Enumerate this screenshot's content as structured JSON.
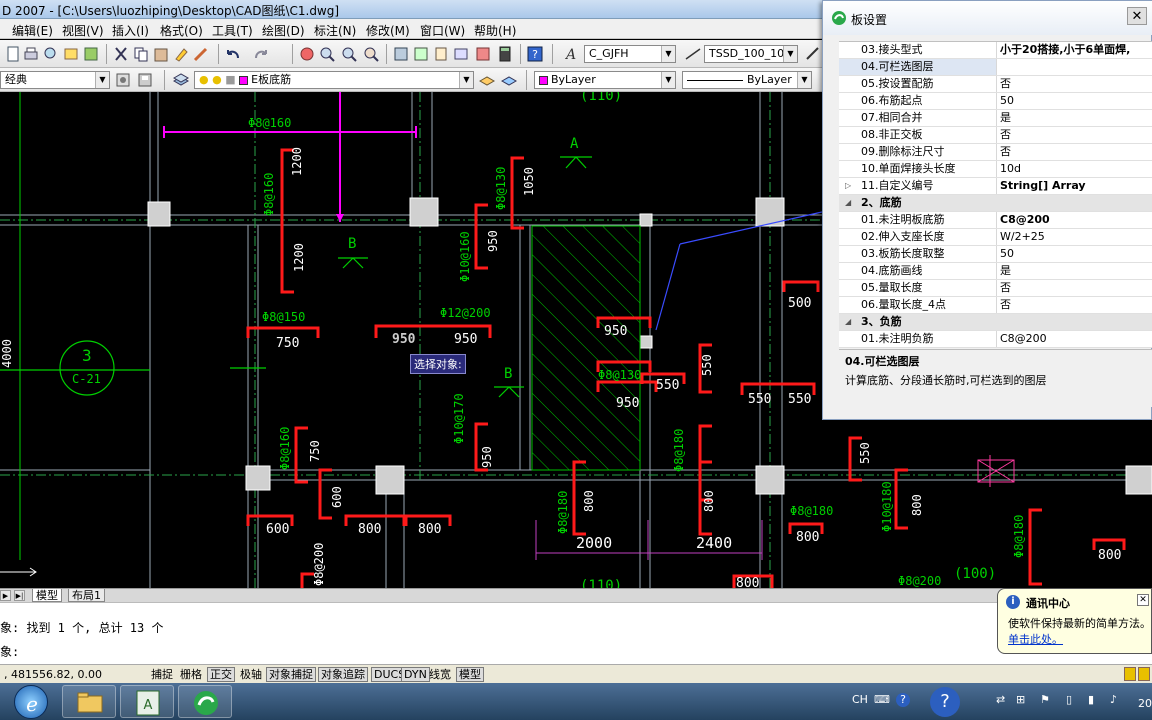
{
  "window": {
    "title": "D 2007 - [C:\\Users\\luozhiping\\Desktop\\CAD图纸\\C1.dwg]"
  },
  "menu": [
    "编辑(E)",
    "视图(V)",
    "插入(I)",
    "格式(O)",
    "工具(T)",
    "绘图(D)",
    "标注(N)",
    "修改(M)",
    "窗口(W)",
    "帮助(H)"
  ],
  "toolbar": {
    "textstyle": "C_GJFH",
    "dimstyle": "TSSD_100_100",
    "workspace": "经典",
    "layer": "E板底筋",
    "color": "ByLayer",
    "linetype": "ByLayer"
  },
  "drawing": {
    "texts": {
      "t8_160": "Φ8@160",
      "t1200a": "1200",
      "t1200b": "1200",
      "t8_160v": "Φ8@160",
      "t8_130": "Φ8@130",
      "t1050": "1050",
      "tA": "A",
      "tB1": "B",
      "t10_160": "Φ10@160",
      "t950a": "950",
      "t8_150": "Φ8@150",
      "t750": "750",
      "t12_200": "Φ12@200",
      "t950b": "950",
      "t950sel": "950",
      "t4000": "4000",
      "tAxis3": "3",
      "tAxisC": "C-21",
      "t950c": "950",
      "t550a": "550",
      "t500": "500",
      "t8_130b": "Φ8@130",
      "t550b": "550",
      "t950d": "950",
      "tB2": "B",
      "t550c": "550",
      "t550d": "550",
      "t10_170": "Φ10@170",
      "t950e": "950",
      "t8_160c": "Φ8@160",
      "t750b": "750",
      "t8_180": "Φ8@180",
      "t8_180b": "Φ8@180",
      "t800a": "800",
      "t800b": "800",
      "t8_180c": "Φ8@180",
      "t10_180": "Φ10@180",
      "t800c": "800",
      "t550e": "550",
      "t600a": "600",
      "t600b": "600",
      "t800d": "800",
      "t800e": "800",
      "t2000": "2000",
      "t2400": "2400",
      "t800f": "800",
      "t8_180d": "Φ8@180",
      "t8_200": "Φ8@200",
      "t100": "(100)",
      "t110": "(110)",
      "t800g": "800",
      "t800h": "800",
      "t8_200b": "Φ8@200",
      "t110top": "(110)",
      "tooltip": "选择对象:"
    }
  },
  "panel": {
    "title": "板设置",
    "rows": [
      {
        "name": "03.接头型式",
        "value": "小于20搭接,小于6单面焊,",
        "style": "bold"
      },
      {
        "name": "04.可栏选图层",
        "value": "",
        "style": "sel"
      },
      {
        "name": "05.按设置配筋",
        "value": "否",
        "style": ""
      },
      {
        "name": "06.布筋起点",
        "value": "50",
        "style": ""
      },
      {
        "name": "07.相同合并",
        "value": "是",
        "style": ""
      },
      {
        "name": "08.非正交板",
        "value": "否",
        "style": ""
      },
      {
        "name": "09.删除标注尺寸",
        "value": "否",
        "style": ""
      },
      {
        "name": "10.单面焊接头长度",
        "value": "10d",
        "style": ""
      },
      {
        "name": "11.自定义编号",
        "value": "String[] Array",
        "style": "bold",
        "expander": "▷"
      },
      {
        "name": "2、底筋",
        "value": "",
        "style": "cat",
        "expander": "◢"
      },
      {
        "name": "01.未注明板底筋",
        "value": "C8@200",
        "style": "bold"
      },
      {
        "name": "02.伸入支座长度",
        "value": "W/2+25",
        "style": ""
      },
      {
        "name": "03.板筋长度取整",
        "value": "50",
        "style": ""
      },
      {
        "name": "04.底筋画线",
        "value": "是",
        "style": ""
      },
      {
        "name": "05.量取长度",
        "value": "否",
        "style": ""
      },
      {
        "name": "06.量取长度_4点",
        "value": "否",
        "style": ""
      },
      {
        "name": "3、负筋",
        "value": "",
        "style": "cat",
        "expander": "◢"
      },
      {
        "name": "01.未注明负筋",
        "value": "C8@200",
        "style": ""
      }
    ],
    "desc_title": "04.可栏选图层",
    "desc_text": "计算底筋、分段通长筋时,可栏选到的图层"
  },
  "tabs": [
    "模型",
    "布局1"
  ],
  "command": {
    "line1": "象: 找到 1 个, 总计 13 个",
    "line2": "象:"
  },
  "status": {
    "coords": ", 481556.82, 0.00",
    "buttons": [
      "捕捉",
      "栅格",
      "正交",
      "极轴",
      "对象捕捉",
      "对象追踪",
      "DUCS",
      "DYN",
      "线宽",
      "模型"
    ]
  },
  "balloon": {
    "title": "通讯中心",
    "message": "使软件保持最新的简单方法。",
    "link": "单击此处。"
  },
  "tray": {
    "lang": "CH",
    "clock": "20"
  },
  "colors": {
    "red": "#ff1a1a",
    "magenta": "#ff00ff",
    "green": "#00d000",
    "grid": "#9cb0c0"
  }
}
